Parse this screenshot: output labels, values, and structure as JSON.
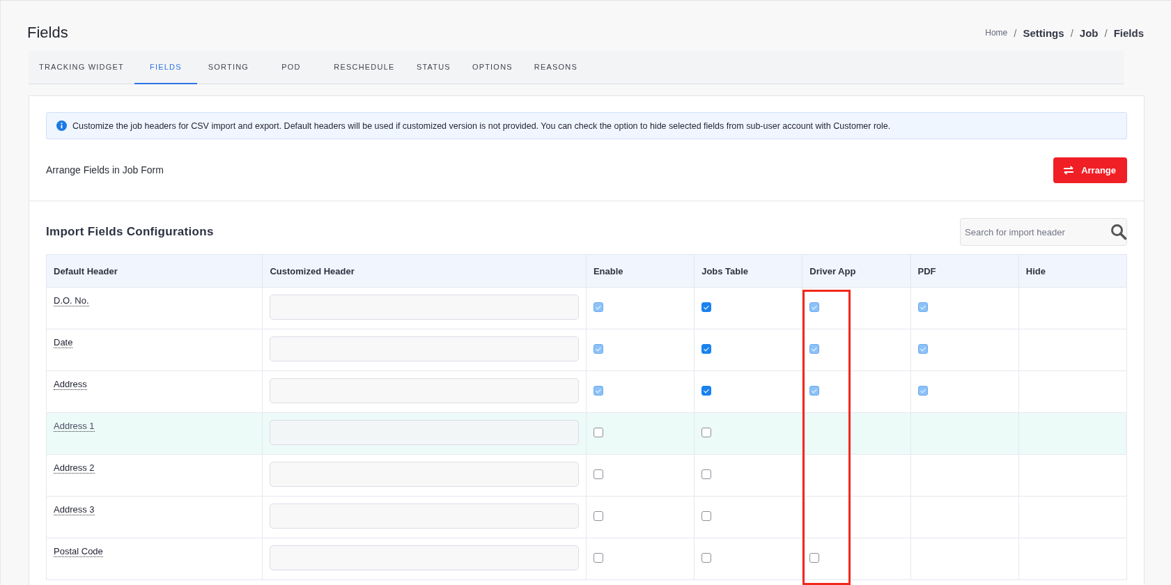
{
  "page_title": "Fields",
  "breadcrumb": [
    {
      "label": "Home",
      "current": false
    },
    {
      "label": "Settings",
      "current": true
    },
    {
      "label": "Job",
      "current": true
    },
    {
      "label": "Fields",
      "current": true
    }
  ],
  "breadcrumb_separator": "/",
  "tabs": [
    {
      "label": "TRACKING WIDGET",
      "selected": false
    },
    {
      "label": "FIELDS",
      "selected": true
    },
    {
      "label": "SORTING",
      "selected": false
    },
    {
      "label": "POD",
      "selected": false
    },
    {
      "label": "RESCHEDULE",
      "selected": false
    },
    {
      "label": "STATUS",
      "selected": false
    },
    {
      "label": "OPTIONS",
      "selected": false
    },
    {
      "label": "REASONS",
      "selected": false
    }
  ],
  "info_message": "Customize the job headers for CSV import and export. Default headers will be used if customized version is not provided. You can check the option to hide selected fields from sub-user account with Customer role.",
  "arrange": {
    "label": "Arrange Fields in Job Form",
    "button": "Arrange"
  },
  "import_section": {
    "title": "Import Fields Configurations",
    "search": {
      "placeholder": "Search for import header"
    }
  },
  "table": {
    "columns": [
      {
        "label": "Default Header",
        "highlighted": false
      },
      {
        "label": "Customized Header",
        "highlighted": false
      },
      {
        "label": "Enable",
        "highlighted": false
      },
      {
        "label": "Jobs Table",
        "highlighted": false
      },
      {
        "label": "Driver App",
        "highlighted": true
      },
      {
        "label": "PDF",
        "highlighted": false
      },
      {
        "label": "Hide",
        "highlighted": false
      }
    ],
    "rows": [
      {
        "header": "D.O. No.",
        "hovered": false,
        "enable": {
          "checked": true,
          "disabled": true
        },
        "jobs_table": {
          "checked": true,
          "disabled": false
        },
        "driver_app": {
          "checked": true,
          "disabled": true
        },
        "pdf": {
          "checked": true,
          "disabled": true
        }
      },
      {
        "header": "Date",
        "hovered": false,
        "enable": {
          "checked": true,
          "disabled": true
        },
        "jobs_table": {
          "checked": true,
          "disabled": false
        },
        "driver_app": {
          "checked": true,
          "disabled": true
        },
        "pdf": {
          "checked": true,
          "disabled": true
        }
      },
      {
        "header": "Address",
        "hovered": false,
        "enable": {
          "checked": true,
          "disabled": true
        },
        "jobs_table": {
          "checked": true,
          "disabled": false
        },
        "driver_app": {
          "checked": true,
          "disabled": true
        },
        "pdf": {
          "checked": true,
          "disabled": true
        }
      },
      {
        "header": "Address 1",
        "hovered": true,
        "enable": {
          "checked": false,
          "disabled": false
        },
        "jobs_table": {
          "checked": false,
          "disabled": false
        }
      },
      {
        "header": "Address 2",
        "hovered": false,
        "enable": {
          "checked": false,
          "disabled": false
        },
        "jobs_table": {
          "checked": false,
          "disabled": false
        }
      },
      {
        "header": "Address 3",
        "hovered": false,
        "enable": {
          "checked": false,
          "disabled": false
        },
        "jobs_table": {
          "checked": false,
          "disabled": false
        }
      },
      {
        "header": "Postal Code",
        "hovered": false,
        "enable": {
          "checked": false,
          "disabled": false
        },
        "jobs_table": {
          "checked": false,
          "disabled": false
        },
        "driver_app": {
          "checked": false,
          "disabled": false
        }
      }
    ]
  }
}
